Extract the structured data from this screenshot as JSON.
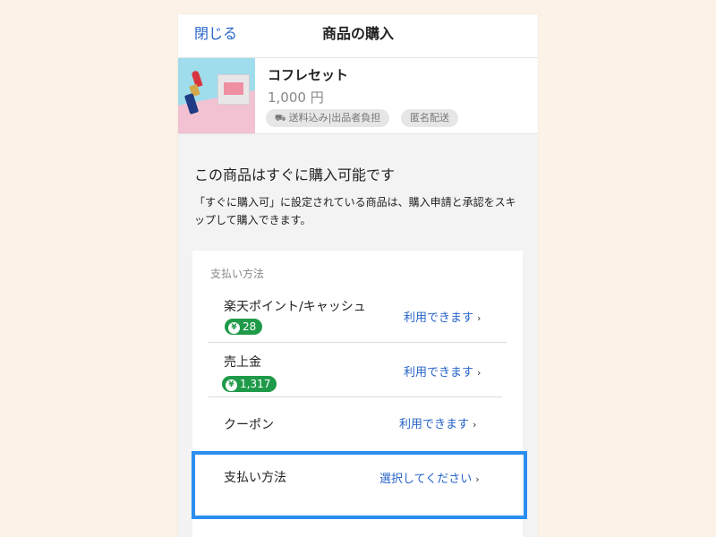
{
  "header": {
    "close_label": "閉じる",
    "title": "商品の購入"
  },
  "product": {
    "name": "コフレセット",
    "price": "1,000 円",
    "tags": [
      "送料込み|出品者負担",
      "匿名配送"
    ]
  },
  "notice": {
    "title": "この商品はすぐに購入可能です",
    "body": "「すぐに購入可」に設定されている商品は、購入申請と承認をスキップして購入できます。"
  },
  "payment": {
    "section_label": "支払い方法",
    "rows": [
      {
        "label": "楽天ポイント/キャッシュ",
        "badge": "28",
        "link": "利用できます"
      },
      {
        "label": "売上金",
        "badge": "1,317",
        "link": "利用できます"
      },
      {
        "label": "クーポン",
        "link": "利用できます"
      }
    ],
    "method": {
      "label": "支払い方法",
      "link": "選択してください"
    }
  },
  "colors": {
    "accent_blue": "#2563c8",
    "highlight_border": "#2b8ef0",
    "badge_green": "#1f9a49",
    "page_background": "#fdf2e8"
  },
  "icons": {
    "chevron": "›",
    "yen": "¥",
    "truck": "⛟"
  }
}
